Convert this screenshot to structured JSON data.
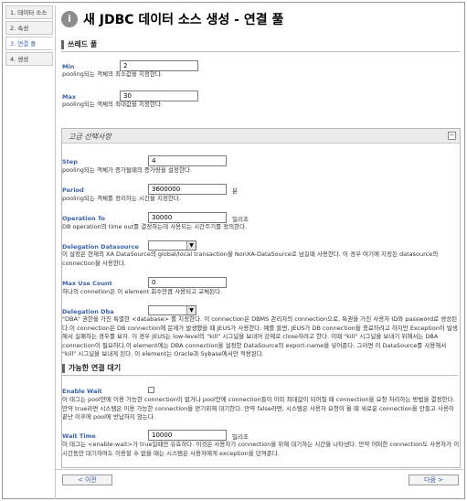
{
  "steps": [
    {
      "label": "1. 데이터 소스"
    },
    {
      "label": "2. 속성"
    },
    {
      "label": "3. 연결 풀"
    },
    {
      "label": "4. 생성"
    }
  ],
  "page": {
    "title": "새 JDBC 데이터 소스 생성 - 연결 풀",
    "icon": "info-icon"
  },
  "thread_section": {
    "title": "쓰레드 풀",
    "min": {
      "label": "Min",
      "value": "2",
      "desc": "pooling되는 객체의 최소값을 지정한다."
    },
    "max": {
      "label": "Max",
      "value": "30",
      "desc": "pooling되는 객체의 최대값을 지정한다."
    }
  },
  "advanced": {
    "title": "고급 선택사항",
    "collapse_symbol": "−",
    "step": {
      "label": "Step",
      "value": "4",
      "desc": "pooling되는 객체가 증가될때의 증가량을 설정한다."
    },
    "period": {
      "label": "Period",
      "value": "3600000",
      "unit": "분",
      "desc": "pooling되는 객체를 정리하는 시간을 지정한다."
    },
    "operation_to": {
      "label": "Operation To",
      "value": "30000",
      "unit": "밀리초",
      "desc": "DB operation의 time out를 결정하는데 사용되는 시간주기를 정의한다."
    },
    "delegation_datasource": {
      "label": "Delegation Datasource",
      "value": "",
      "desc": "이 설정은 현재의 XA DataSource의 global/local transaction을 NonXA-DataSource로 넘길때 사용한다. 이 경우 여기에 지정된 datasource의 connection을 사용한다."
    },
    "max_use_count": {
      "label": "Max Use Count",
      "value": "0",
      "desc": "하나의 connetion은 이 element 회수만큼 사용되고 교체된다."
    },
    "delegation_dba": {
      "label": "Delegation Dba",
      "value": "",
      "desc": "\"DBA\" 권한을 가진 특별한 <database> 를 지정한다. 이 connection은 DBMS 관리자의 connection으로, 특권을 가진 사용자 ID와 password로 생성된다.이 connection은 DB connection에 문제가 발생했을 때 JEUS가 사용한다. 예를 들면, JEUS가 DB connection을 종료하려고 하지만 Exception이 발생해서 실패하는 경우를 보자. 이 경우 JEUS는 low-level의 \"kill\" 시그널을 보내어 강제로 close하려고 한다. 이때 \"kill\" 시그널을 보내기 위해서는 DBA connection이 필요하다.이 element에는 DBA connection을 설정한 DataSource의 export-name을 넣어준다. 그러면 이 DataSource를 사용해서 \"kill\" 시그널을 보내게 된다. 이 element는 Oracle과 Sybase에서만 적용된다."
    }
  },
  "wait_section": {
    "title": "가능한 연결 대기",
    "enable_wait": {
      "label": "Enable Wait",
      "checked": false,
      "desc": "이 태그는 pool안에 이용 가능한 connection이 없거나 pool안에 connection들이 이미 최대값이 되어질 때 connection을 요청 처리하는 방법을 결정한다. 만약 true라면 시스템은 이용 가능한 connection을 얻기위해 대기한다. 만약 false라면, 시스템은 사용자 요청이 올 때 새로운 connection을 만들고 사용이 끝난 이후에 pool에 반납하지 않는다."
    },
    "wait_time": {
      "label": "Wait Time",
      "value": "10000",
      "unit": "밀리초",
      "desc": "이 태그는 <enable-wait>가 true일때만 유효하다. 이것은 사용자가 connection을 위해 대기하는 시간을 나타낸다. 만약 어떠한 connection도 사용자가 이 시간동안 대기하여도 이용할 수 없을 때는 시스템은 사용자에게 exception을 던져준다."
    }
  },
  "footer": {
    "prev_label": "< 이전",
    "next_label": "다음 >"
  }
}
